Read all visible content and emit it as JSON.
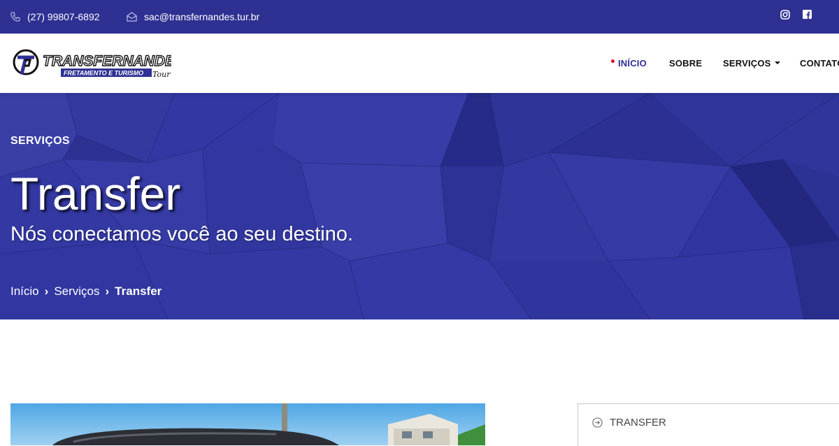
{
  "topbar": {
    "phone": "(27) 99807-6892",
    "email": "sac@transfernandes.tur.br",
    "social": [
      "instagram-icon",
      "facebook-icon"
    ],
    "bg_color": "#2e3192"
  },
  "logo": {
    "name": "TRANSFERNANDES",
    "tagline": "FRETAMENTO E TURISMO",
    "script": "Tour"
  },
  "nav": {
    "items": [
      {
        "label": "INÍCIO",
        "active": true
      },
      {
        "label": "SOBRE"
      },
      {
        "label": "SERVIÇOS",
        "dropdown": true
      },
      {
        "label": "CONTATO"
      }
    ]
  },
  "hero": {
    "kicker": "SERVIÇOS",
    "title": "Transfer",
    "subtitle": "Nós conectamos você ao seu destino.",
    "breadcrumb": [
      "Início",
      "Serviços",
      "Transfer"
    ]
  },
  "sidebar": {
    "items": [
      {
        "label": "TRANSFER"
      }
    ]
  },
  "colors": {
    "brand": "#2e3192",
    "accent_dot": "#e0102a"
  }
}
